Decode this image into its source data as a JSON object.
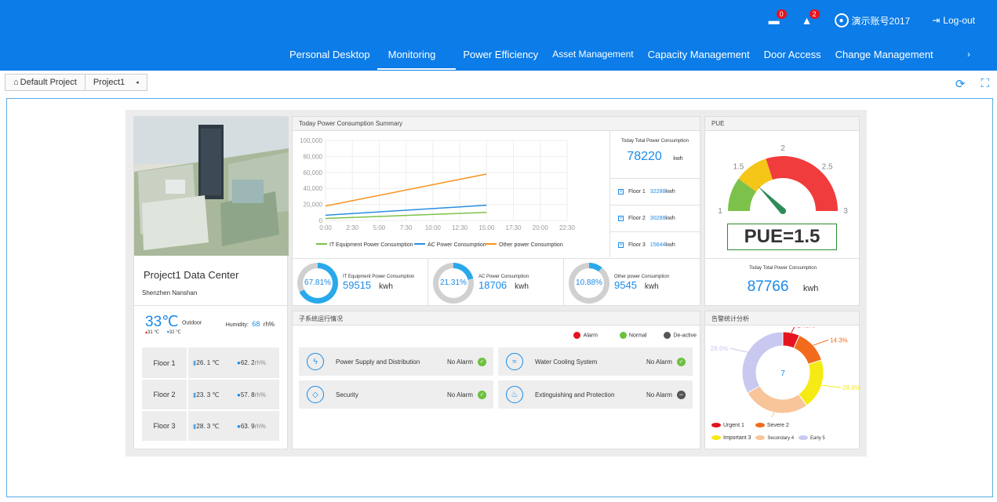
{
  "topbar": {
    "msg_badge": "0",
    "alarm_badge": "2",
    "user": "演示账号2017",
    "logout": "Log-out"
  },
  "nav": {
    "items": [
      "Personal  Desktop",
      "Monitoring",
      "Power Efficiency",
      "Asset Management",
      "Capacity Management",
      "Door Access",
      "Change Management"
    ],
    "active": "Monitoring",
    "more": "›"
  },
  "breadcrumb": {
    "home": "Default Project",
    "current": "Project1"
  },
  "project": {
    "name": "Project1 Data Center",
    "location": "Shenzhen Nanshan",
    "temp": "33℃",
    "outdoor": "Outdoor",
    "humidity_label": "Humidity:",
    "humidity_value": "68",
    "humidity_unit": "rh%",
    "temp_low": "31 ℃",
    "temp_high": "32 ℃",
    "floors": [
      {
        "name": "Floor 1",
        "temp": "26. 1 ℃",
        "hum": "62. 2",
        "unit": "rh%"
      },
      {
        "name": "Floor 2",
        "temp": "23. 3 ℃",
        "hum": "57. 8",
        "unit": "rh%"
      },
      {
        "name": "Floor 3",
        "temp": "28. 3 ℃",
        "hum": "63. 9",
        "unit": "rh%"
      }
    ]
  },
  "summary": {
    "title": "Today Power Consumption Summary",
    "total_label": "Today Total Power Consumption",
    "total_value": "78220",
    "total_unit": "kwh",
    "floors": [
      {
        "name": "Floor 1",
        "value": "32288",
        "unit": "kwh"
      },
      {
        "name": "Floor 2",
        "value": "30288",
        "unit": "kwh"
      },
      {
        "name": "Floor 3",
        "value": "15644",
        "unit": "kwh"
      }
    ],
    "donuts": [
      {
        "pct": "67.81%",
        "frac": 0.6781,
        "label": "IT Equipment Power Consumption",
        "value": "59515",
        "unit": "kwh"
      },
      {
        "pct": "21.31%",
        "frac": 0.2131,
        "label": "AC Power Consumption",
        "value": "18706",
        "unit": "kwh"
      },
      {
        "pct": "10.88%",
        "frac": 0.1088,
        "label": "Other power Consumption",
        "value": "9545",
        "unit": "kwh"
      }
    ]
  },
  "chart_data": {
    "type": "line",
    "x": [
      "0:00",
      "2:30",
      "5:00",
      "7:30",
      "10:00",
      "12:30",
      "15:00",
      "17:30",
      "20:00",
      "22:30"
    ],
    "ylim": [
      0,
      100000
    ],
    "yticks": [
      "100,000",
      "80,000",
      "60,000",
      "40,000",
      "20,000",
      "0"
    ],
    "series": [
      {
        "name": "IT Equipment Power Consumption",
        "color": "#7cc24a",
        "start": 2500,
        "end": 10000
      },
      {
        "name": "AC Power Consumption",
        "color": "#2a8de0",
        "start": 6500,
        "end": 19000
      },
      {
        "name": "Other power Consumption",
        "color": "#f7931e",
        "start": 18000,
        "end": 58000
      }
    ]
  },
  "pue": {
    "title": "PUE",
    "value_text": "PUE=1.5",
    "value": 1.5,
    "ticks": [
      "1",
      "1.5",
      "2",
      "2.5",
      "3"
    ],
    "total_label": "Today Total Power Consumption",
    "total_value": "87766",
    "total_unit": "kwh"
  },
  "subsystems": {
    "title": "子系统运行情况",
    "legend": [
      "Alarm",
      "Normal",
      "De-active"
    ],
    "items": [
      {
        "name": "Power Supply and Distribution",
        "status": "No Alarm",
        "state": "ok",
        "icon": "lightning-icon"
      },
      {
        "name": "Water Cooling System",
        "status": "No Alarm",
        "state": "ok",
        "icon": "water-icon"
      },
      {
        "name": "Security",
        "status": "No Alarm",
        "state": "ok",
        "icon": "shield-icon"
      },
      {
        "name": "Extinguishing and Protection",
        "status": "No Alarm",
        "state": "off",
        "icon": "fire-icon"
      }
    ]
  },
  "alarmstats": {
    "title": "告警统计分析",
    "center": "7",
    "slices": [
      {
        "name": "Urgent",
        "count": 1,
        "pct": "14.3%",
        "color": "#e5141e"
      },
      {
        "name": "Severe",
        "count": 2,
        "pct": "14.3%",
        "color": "#f26b1d"
      },
      {
        "name": "Important",
        "count": 3,
        "pct": "28.6%",
        "color": "#f5ea14"
      },
      {
        "name": "Secondary",
        "count": 4,
        "pct": "14.3%",
        "color": "#f8c49a"
      },
      {
        "name": "Early",
        "count": 5,
        "pct": "28.6%",
        "color": "#c8c8f0"
      }
    ],
    "legend": [
      "Urgent 1",
      "Severe 2",
      "Important 3",
      "Secondary 4",
      "Early 5"
    ]
  }
}
